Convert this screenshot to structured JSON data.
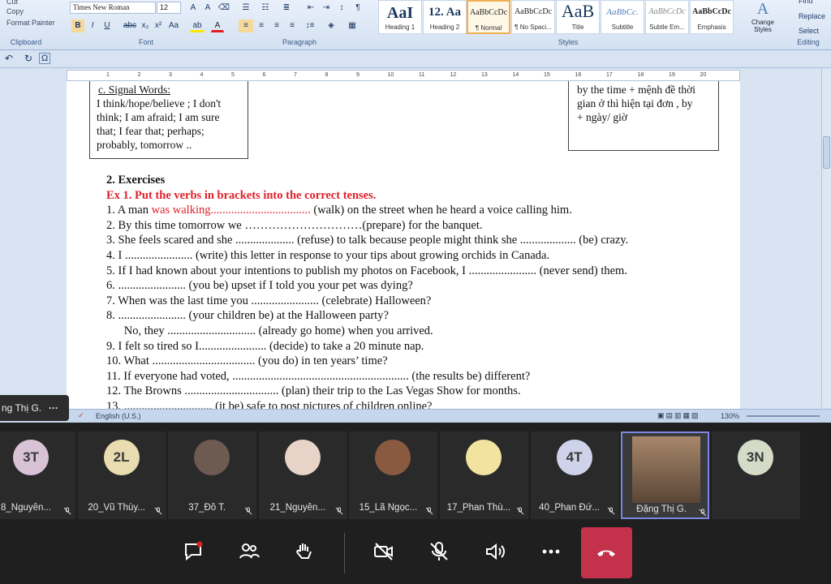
{
  "ribbon": {
    "clipboard": {
      "cut": "Cut",
      "copy": "Copy",
      "format_painter": "Format Painter",
      "label": "Clipboard"
    },
    "font": {
      "family": "Times New Roman",
      "size": "12",
      "label": "Font"
    },
    "paragraph": {
      "label": "Paragraph"
    },
    "styles": {
      "label": "Styles",
      "items": [
        {
          "preview": "AaI",
          "name": "Heading 1"
        },
        {
          "preview": "12. Aa",
          "name": "Heading 2"
        },
        {
          "preview": "AaBbCcDc",
          "name": "¶ Normal"
        },
        {
          "preview": "AaBbCcDc",
          "name": "¶ No Spaci..."
        },
        {
          "preview": "AaB",
          "name": "Title"
        },
        {
          "preview": "AaBbCc.",
          "name": "Subtitle"
        },
        {
          "preview": "AaBbCcDc",
          "name": "Subtle Em..."
        },
        {
          "preview": "AaBbCcDc",
          "name": "Emphasis"
        }
      ],
      "change_styles": "Change Styles"
    },
    "editing": {
      "find": "Find",
      "replace": "Replace",
      "select": "Select",
      "label": "Editing"
    }
  },
  "ruler_ticks": [
    "1",
    "2",
    "3",
    "4",
    "5",
    "6",
    "7",
    "8",
    "9",
    "10",
    "11",
    "12",
    "13",
    "14",
    "15",
    "16",
    "17",
    "18",
    "19",
    "20"
  ],
  "document": {
    "left_box": {
      "title": "c. Signal Words:",
      "lines": [
        "I think/hope/believe ; I don't",
        "think; I am afraid; I am sure",
        "that; I fear that; perhaps;",
        "probably, tomorrow .."
      ]
    },
    "right_box": {
      "lines": [
        "by the time + mệnh đề thời",
        "gian ở thì hiện tại đơn , by",
        "+ ngày/ giờ"
      ]
    },
    "heading": "2. Exercises",
    "ex_title": "Ex 1. Put the verbs in brackets into the correct tenses.",
    "items": [
      {
        "pre": "1. A man ",
        "answer": "was walking..................................",
        "post": " (walk) on the street when he heard a voice calling him."
      },
      {
        "pre": "2. By this time tomorrow we …………………………(prepare) for the banquet.",
        "answer": "",
        "post": ""
      },
      {
        "pre": "3. She feels scared and she .................... (refuse) to talk because people might think she ................... (be) crazy.",
        "answer": "",
        "post": ""
      },
      {
        "pre": "4. I ....................... (write) this letter in response to your tips about growing orchids in Canada.",
        "answer": "",
        "post": ""
      },
      {
        "pre": "5. If I had known about your intentions to publish my photos on Facebook, I ....................... (never send) them.",
        "answer": "",
        "post": ""
      },
      {
        "pre": "6. ....................... (you be) upset if I told you your pet was dying?",
        "answer": "",
        "post": ""
      },
      {
        "pre": "7. When was the last time you ....................... (celebrate) Halloween?",
        "answer": "",
        "post": ""
      },
      {
        "pre": "8. ....................... (your children be) at the Halloween party?",
        "answer": "",
        "post": ""
      },
      {
        "pre": "      No, they .............................. (already go home) when you arrived.",
        "answer": "",
        "post": ""
      },
      {
        "pre": "9. I felt so tired so I....................... (decide) to take a 20 minute nap.",
        "answer": "",
        "post": ""
      },
      {
        "pre": "10. What ................................... (you do) in ten years’ time?",
        "answer": "",
        "post": ""
      },
      {
        "pre": "11. If everyone had voted, ............................................................ (the results be) different?",
        "answer": "",
        "post": ""
      },
      {
        "pre": "12. The Browns ................................ (plan) their trip to the Las Vegas Show for months.",
        "answer": "",
        "post": ""
      },
      {
        "pre": "13. .............................. (it be) safe to post pictures of children online?",
        "answer": "",
        "post": ""
      }
    ]
  },
  "status": {
    "language": "English (U.S.)",
    "zoom": "130%"
  },
  "presenter_name": "ng Thị G.",
  "participants": [
    {
      "initials": "3T",
      "name": "8_Nguyễn...",
      "color": "#d8c3d6",
      "type": "initials"
    },
    {
      "initials": "2L",
      "name": "20_Vũ Thùy...",
      "color": "#e8dcb0",
      "type": "initials"
    },
    {
      "initials": "",
      "name": "37_Đỗ T.",
      "color": "#6d5a50",
      "type": "photo"
    },
    {
      "initials": "",
      "name": "21_Nguyễn...",
      "color": "#e8d3c8",
      "type": "photo"
    },
    {
      "initials": "",
      "name": "15_Lã Ngọc...",
      "color": "#8a5a40",
      "type": "photo"
    },
    {
      "initials": "",
      "name": "17_Phan Thù...",
      "color": "#f2e3a0",
      "type": "photo"
    },
    {
      "initials": "4T",
      "name": "40_Phan Đứ...",
      "color": "#cfd3ea",
      "type": "initials"
    },
    {
      "initials": "",
      "name": "Đặng Thị G.",
      "color": "#a8876b",
      "type": "camera"
    },
    {
      "initials": "3N",
      "name": "",
      "color": "#d4dcc8",
      "type": "initials"
    }
  ],
  "controls": [
    "chat-icon",
    "participants-icon",
    "raise-hand-icon",
    "camera-off-icon",
    "mic-off-icon",
    "speaker-icon",
    "more-icon",
    "leave-call-icon"
  ]
}
